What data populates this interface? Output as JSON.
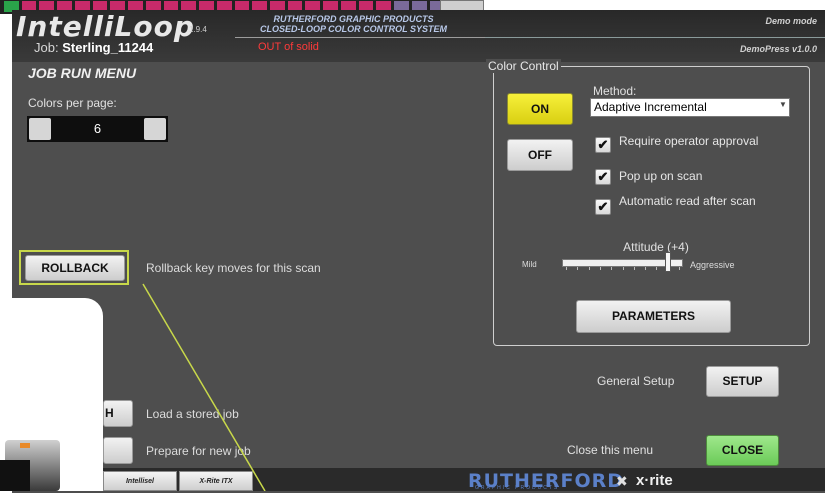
{
  "background_strip": {
    "colors": [
      "#2aa44a",
      "#c82a6a",
      "#c82a6a",
      "#c82a6a",
      "#c82a6a",
      "#c82a6a",
      "#c82a6a",
      "#c82a6a",
      "#c82a6a",
      "#c82a6a",
      "#c82a6a",
      "#c82a6a",
      "#c82a6a",
      "#c82a6a",
      "#c82a6a",
      "#c82a6a",
      "#c82a6a",
      "#c82a6a",
      "#c82a6a",
      "#c82a6a",
      "#c82a6a",
      "#c82a6a",
      "#7a6a9a",
      "#7a6a9a",
      "#7a6a9a",
      "#2aa44a",
      "#2aa44a"
    ]
  },
  "header": {
    "app_name": "IntelliLoop",
    "version": "1.9.4",
    "company_line1": "RUTHERFORD GRAPHIC PRODUCTS",
    "company_line2": "CLOSED-LOOP COLOR CONTROL SYSTEM",
    "demo_mode": "Demo mode",
    "press": "DemoPress v1.0.0"
  },
  "job": {
    "label": "Job:",
    "name": "Sterling_11244",
    "status": "OUT of solid"
  },
  "menu": {
    "title": "JOB RUN MENU",
    "colors_per_page_label": "Colors per page:",
    "colors_per_page_value": "6",
    "rollback_button": "ROLLBACK",
    "rollback_text": "Rollback key moves for this scan",
    "load_button": "H",
    "load_text": "Load a stored job",
    "prepare_button": "",
    "prepare_text": "Prepare for new job"
  },
  "color_control": {
    "title": "Color Control",
    "on_button": "ON",
    "off_button": "OFF",
    "method_label": "Method:",
    "method_value": "Adaptive Incremental",
    "options": [
      {
        "label": "Require operator approval",
        "checked": true
      },
      {
        "label": "Pop up on scan",
        "checked": true
      },
      {
        "label": "Automatic read after scan",
        "checked": true
      }
    ],
    "attitude_label": "Attitude (+4)",
    "attitude_value": 4,
    "attitude_min": -5,
    "attitude_max": 5,
    "mild_label": "Mild",
    "aggressive_label": "Aggressive",
    "parameters_button": "PARAMETERS"
  },
  "setup": {
    "label": "General Setup",
    "button": "SETUP"
  },
  "close": {
    "label": "Close this menu",
    "button": "CLOSE"
  },
  "bottom": {
    "tabs": [
      "Intellisel",
      "X-Rite ITX"
    ],
    "brand_rutherford": "RUTHERFORD",
    "brand_rutherford_sub": "GRAPHIC PRODUCTS",
    "brand_xrite": "x·rite"
  },
  "colors": {
    "on_yellow": "#f0e830",
    "close_green": "#88dd72",
    "callout_yellow": "#c8d84a",
    "status_red": "#ff3a3a"
  }
}
